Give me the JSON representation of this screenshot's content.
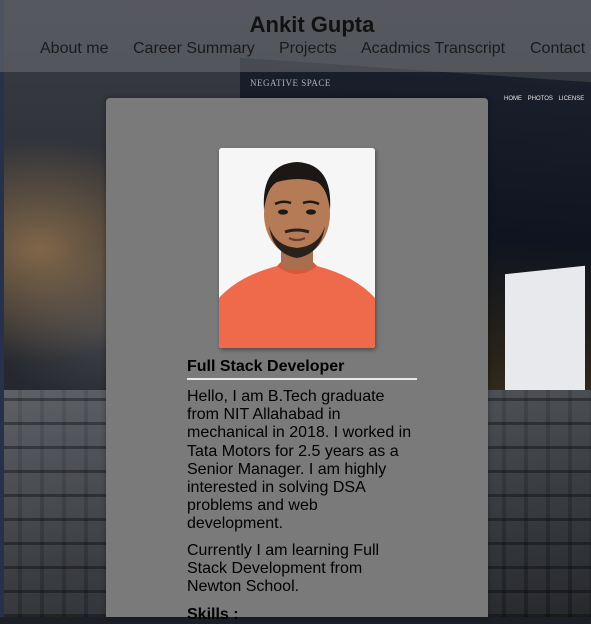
{
  "header": {
    "title": "Ankit Gupta",
    "nav": [
      "About me",
      "Career Summary",
      "Projects",
      "Acadmics Transcript",
      "Contact"
    ]
  },
  "background": {
    "screen_label": "NEGATIVE SPACE",
    "screen_nav": "HOME PHOTOS LICENSE"
  },
  "profile": {
    "role": "Full Stack Developer",
    "bio": "Hello, I am B.Tech graduate from NIT Allahabad in mechanical in 2018. I worked in Tata Motors for 2.5 years as a Senior Manager. I am highly interested in solving DSA problems and web development.",
    "current": "Currently I am learning Full Stack Development from Newton School.",
    "skills_heading": "Skills :"
  },
  "colors": {
    "card": "#7a7a7a",
    "header_overlay": "#6e7074",
    "shirt": "#ef6a4c"
  }
}
